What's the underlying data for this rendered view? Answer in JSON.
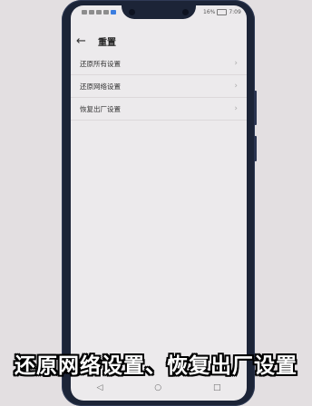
{
  "status_bar": {
    "battery_percent": "16%",
    "time": "7:09"
  },
  "header": {
    "back_icon": "arrow-left-icon",
    "title": "重置"
  },
  "settings": {
    "items": [
      {
        "label": "还原所有设置",
        "icon": "chevron-right-icon"
      },
      {
        "label": "还原网络设置",
        "icon": "chevron-right-icon"
      },
      {
        "label": "恢复出厂设置",
        "icon": "chevron-right-icon"
      }
    ]
  },
  "caption": "还原网络设置、恢复出厂设置"
}
